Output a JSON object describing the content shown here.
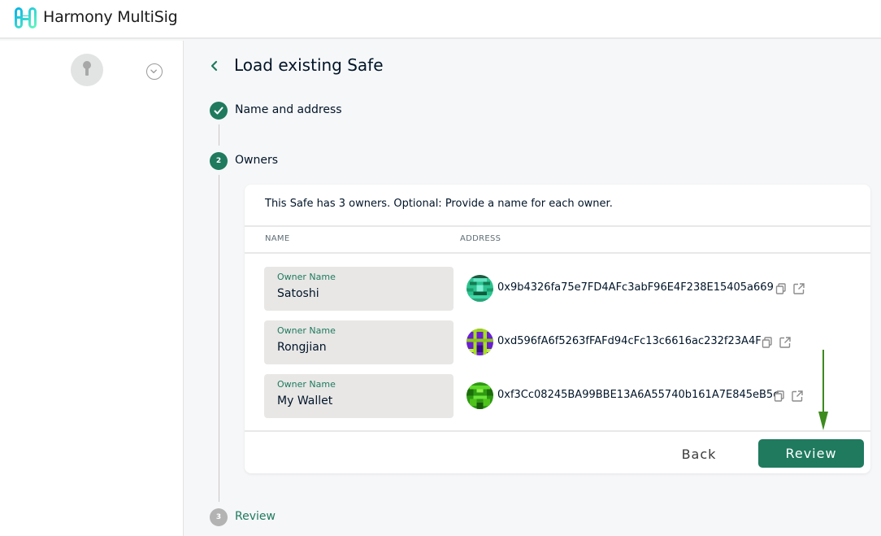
{
  "app": {
    "title": "Harmony MultiSig"
  },
  "page": {
    "title": "Load existing Safe"
  },
  "steps": [
    {
      "number": "",
      "label": "Name and address",
      "state": "completed"
    },
    {
      "number": "2",
      "label": "Owners",
      "state": "active"
    },
    {
      "number": "3",
      "label": "Review",
      "state": "pending"
    }
  ],
  "owners_card": {
    "description": "This Safe has 3 owners. Optional: Provide a name for each owner.",
    "columns": {
      "name": "NAME",
      "address": "ADDRESS"
    },
    "owners": [
      {
        "field_label": "Owner Name",
        "name": "Satoshi",
        "address": "0x9b4326fa75e7FD4AFc3abF96E4F238E15405a669"
      },
      {
        "field_label": "Owner Name",
        "name": "Rongjian",
        "address": "0xd596fA6f5263fFAFd94cFc13c6616ac232f23A4F"
      },
      {
        "field_label": "Owner Name",
        "name": "My Wallet",
        "address": "0xf3Cc08245BA99BBE13A6A55740b161A7E845eB5c"
      }
    ],
    "buttons": {
      "back": "Back",
      "review": "Review"
    }
  },
  "colors": {
    "primary": "#1f7a5e",
    "annotation_arrow": "#3d8a1f"
  },
  "icons": [
    "harmony-logo-icon",
    "keyhole-icon",
    "chevron-down-icon",
    "chevron-left-icon",
    "check-icon",
    "copy-icon",
    "external-link-icon"
  ]
}
